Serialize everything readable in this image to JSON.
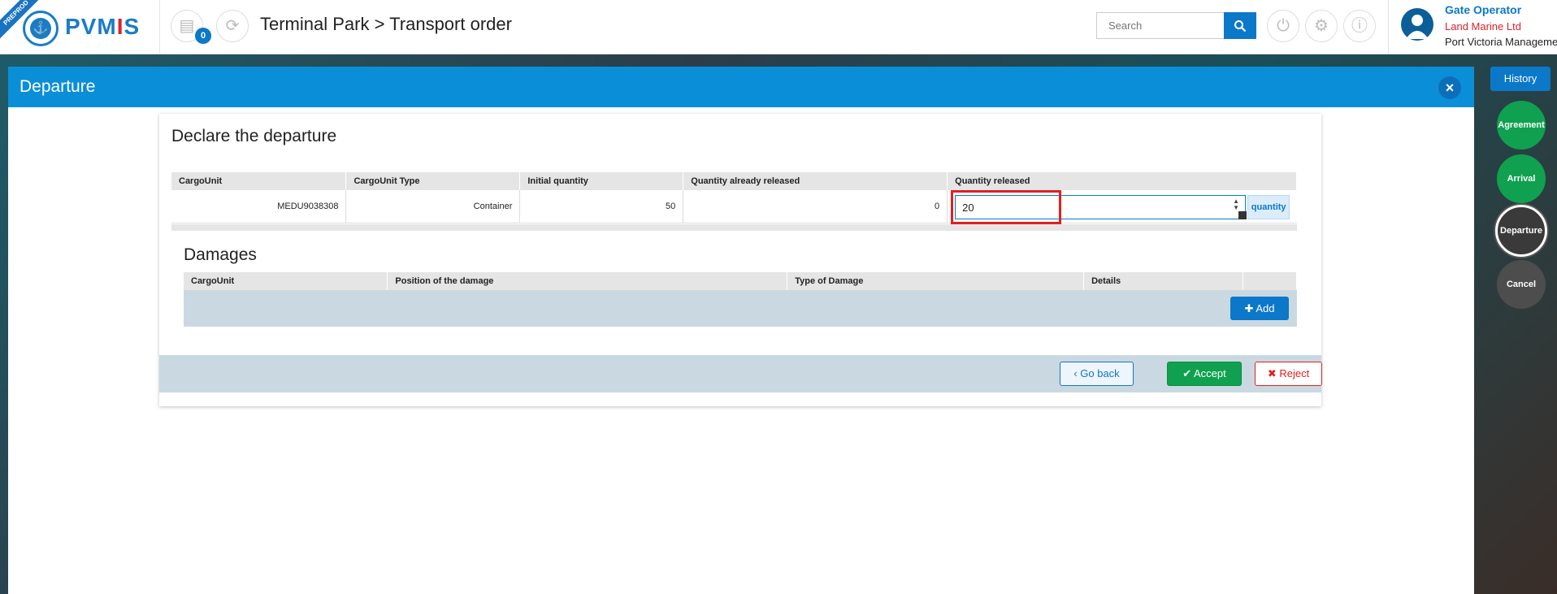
{
  "app": {
    "ribbon": "PREPROD",
    "logo_text_left": "PVM",
    "logo_text_mid": "I",
    "logo_text_right": "S"
  },
  "header": {
    "badge_count": "0",
    "title": "Terminal Park > Transport order"
  },
  "search": {
    "placeholder": "Search"
  },
  "user": {
    "name": "Gate Operator",
    "org": "Land Marine Ltd",
    "port": "Port Victoria Management"
  },
  "workflow": {
    "history_label": "History",
    "steps": [
      {
        "label": "Agreement",
        "state": "done"
      },
      {
        "label": "Arrival",
        "state": "done"
      },
      {
        "label": "Departure",
        "state": "active"
      },
      {
        "label": "Cancel",
        "state": "inactive"
      }
    ]
  },
  "modal": {
    "title": "Departure",
    "card_title": "Declare the departure",
    "table": {
      "headers": [
        "CargoUnit",
        "CargoUnit Type",
        "Initial quantity",
        "Quantity already released",
        "Quantity released"
      ],
      "row": {
        "cargo_unit": "MEDU9038308",
        "type": "Container",
        "initial": "50",
        "released_already": "0",
        "released": "20"
      },
      "quantity_tag": "quantity"
    },
    "damages": {
      "title": "Damages",
      "headers": [
        "CargoUnit",
        "Position of the damage",
        "Type of Damage",
        "Details",
        ""
      ],
      "add_label": "Add"
    },
    "actions": {
      "back": "Go back",
      "accept": "Accept",
      "reject": "Reject"
    }
  }
}
